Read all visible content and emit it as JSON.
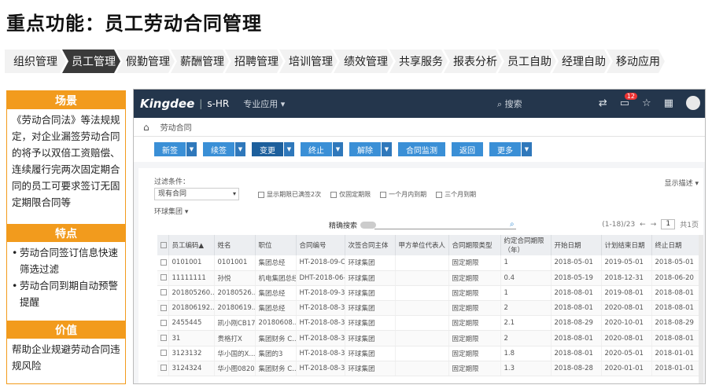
{
  "title": "重点功能：员工劳动合同管理",
  "nav": [
    {
      "label": "组织管理",
      "active": false
    },
    {
      "label": "员工管理",
      "active": true
    },
    {
      "label": "假勤管理",
      "active": false
    },
    {
      "label": "薪酬管理",
      "active": false
    },
    {
      "label": "招聘管理",
      "active": false
    },
    {
      "label": "培训管理",
      "active": false
    },
    {
      "label": "绩效管理",
      "active": false
    },
    {
      "label": "共享服务",
      "active": false
    },
    {
      "label": "报表分析",
      "active": false
    },
    {
      "label": "员工自助",
      "active": false
    },
    {
      "label": "经理自助",
      "active": false
    },
    {
      "label": "移动应用",
      "active": false
    }
  ],
  "sections": {
    "scene": {
      "heading": "场景",
      "text": "《劳动合同法》等法规规定，对企业漏签劳动合同的将予以双倍工资赔偿、连续履行完两次固定期合同的员工可要求签订无固定期限合同等"
    },
    "features": {
      "heading": "特点",
      "items": [
        "劳动合同签订信息快速筛选过滤",
        "劳动合同到期自动预警提醒"
      ]
    },
    "value": {
      "heading": "价值",
      "text": "帮助企业规避劳动合同违规风险"
    }
  },
  "app": {
    "logo": "Kingdee",
    "product": "s-HR",
    "menu": "专业应用",
    "search": "搜索",
    "badge": "12",
    "breadcrumb": "劳动合同",
    "buttons": [
      {
        "label": "新签",
        "dropdown": true,
        "dark": false
      },
      {
        "label": "续签",
        "dropdown": true,
        "dark": false
      },
      {
        "label": "变更",
        "dropdown": true,
        "dark": true
      },
      {
        "label": "终止",
        "dropdown": true,
        "dark": false
      },
      {
        "label": "解除",
        "dropdown": true,
        "dark": false
      },
      {
        "label": "合同监测",
        "dropdown": false,
        "dark": false
      },
      {
        "label": "返回",
        "dropdown": false,
        "dark": false
      },
      {
        "label": "更多",
        "dropdown": true,
        "dark": false
      }
    ],
    "filter_label": "过滤条件：",
    "filter_value": "现有合同",
    "checkboxes": [
      "显示期限已满签2次",
      "仅固定期限",
      "一个月内到期",
      "三个月到期"
    ],
    "env": "环球集团",
    "advanced": "显示描述",
    "exact_label": "精确搜索",
    "pager_text": "(1-18)/23",
    "page_value": "1",
    "page_total": "共1页",
    "columns": [
      "员工编码▲",
      "姓名",
      "职位",
      "合同编号",
      "次签合同主体",
      "甲方单位代表人",
      "合同期限类型",
      "约定合同期限（年）",
      "开始日期",
      "计划结束日期",
      "终止日期"
    ],
    "rows": [
      [
        "0101001",
        "0101001",
        "集团总经",
        "HT-2018-09-C...",
        "环球集团",
        "",
        "固定期限",
        "1",
        "2018-05-01",
        "2019-05-01",
        "2018-05-01"
      ],
      [
        "11111111",
        "孙悦",
        "机电集团总经理",
        "DHT-2018-06-...",
        "环球集团",
        "",
        "固定期限",
        "0.4",
        "2018-05-19",
        "2018-12-31",
        "2018-06-20"
      ],
      [
        "201805260...",
        "20180526...",
        "集团总经",
        "HT-2018-09-3...",
        "环球集团",
        "",
        "固定期限",
        "1",
        "2018-08-01",
        "2019-08-01",
        "2018-08-01"
      ],
      [
        "201806192...",
        "20180619...",
        "集团总经",
        "HT-2018-08-3...",
        "环球集团",
        "",
        "固定期限",
        "2",
        "2018-08-01",
        "2020-08-01",
        "2018-08-01"
      ],
      [
        "2455445",
        "凯小刚CB17",
        "20180608...",
        "HT-2018-08-3...",
        "环球集团",
        "",
        "固定期限",
        "2.1",
        "2018-08-29",
        "2020-10-01",
        "2018-08-29"
      ],
      [
        "31",
        "贵格打X",
        "集团财务 C...",
        "HT-2018-08-3...",
        "环球集团",
        "",
        "固定期限",
        "2",
        "2018-08-01",
        "2020-08-01",
        "2018-08-01"
      ],
      [
        "3123132",
        "华小国的X...",
        "集团的3",
        "HT-2018-08-3...",
        "环球集团",
        "",
        "固定期限",
        "1.8",
        "2018-08-01",
        "2020-05-01",
        "2018-01-01"
      ],
      [
        "3124324",
        "华小图0820",
        "集团财务 C...",
        "HT-2018-08-3...",
        "环球集团",
        "",
        "固定期限",
        "1.3",
        "2018-08-28",
        "2020-01-01",
        "2018-01-01"
      ]
    ]
  },
  "colors": {
    "accent": "#f29b1d",
    "nav_active": "#3a3a3a",
    "topbar": "#24364c",
    "button": "#3a8fd6"
  }
}
